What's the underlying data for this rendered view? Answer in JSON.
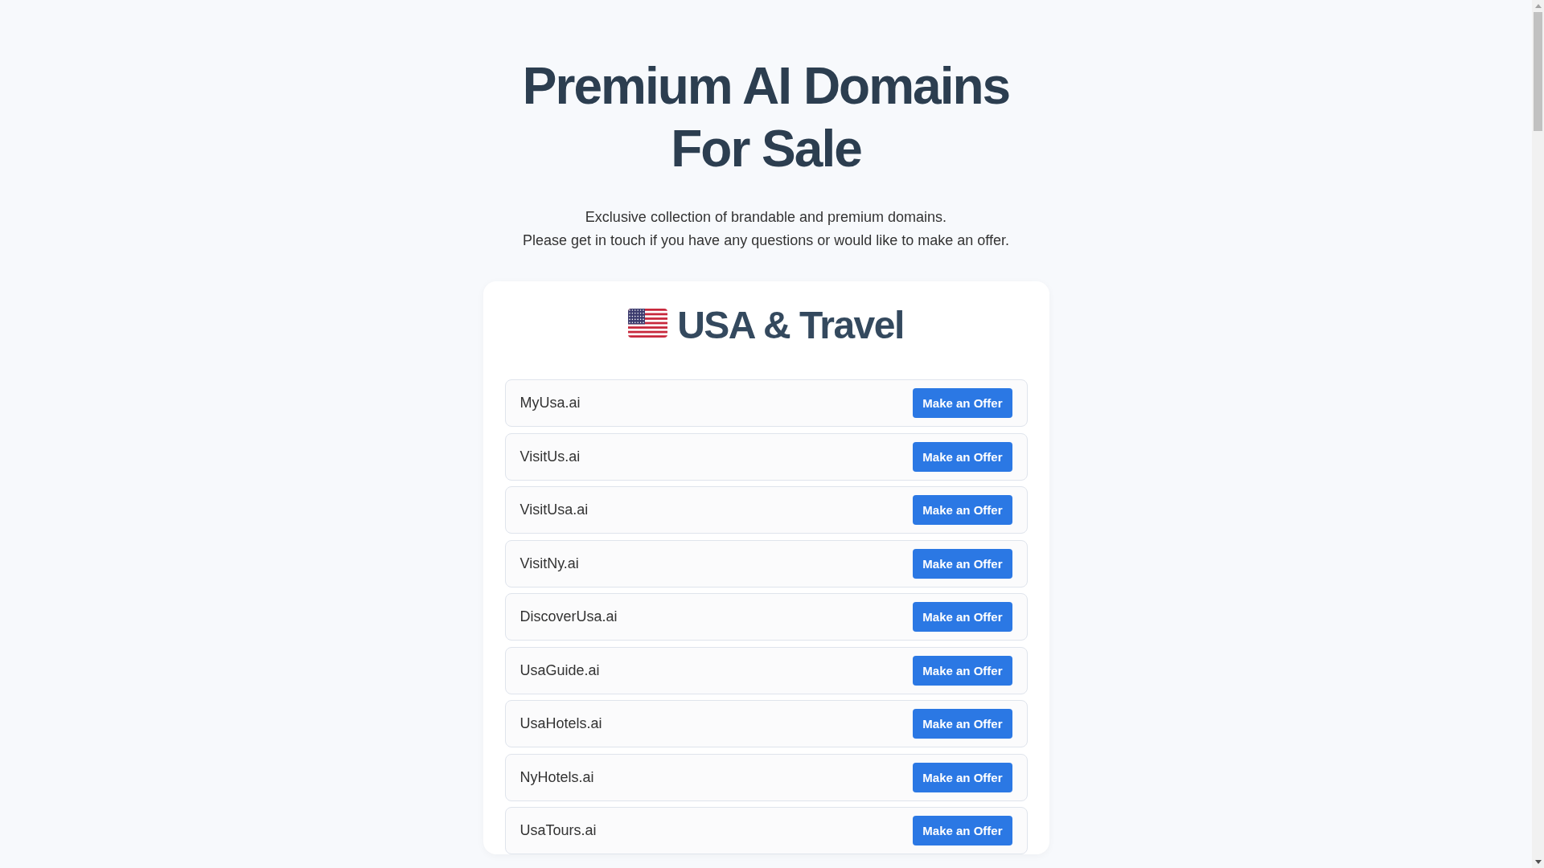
{
  "heading": {
    "title_lines": [
      "Premium AI Domains",
      "For Sale"
    ],
    "subtitle_lines": [
      "Exclusive collection of brandable and premium domains.",
      "Please get in touch if you have any questions or would like to make an offer."
    ]
  },
  "category": {
    "title": "USA & Travel",
    "domains": [
      {
        "name": "MyUsa.ai",
        "button": "Make an Offer"
      },
      {
        "name": "VisitUs.ai",
        "button": "Make an Offer"
      },
      {
        "name": "VisitUsa.ai",
        "button": "Make an Offer"
      },
      {
        "name": "VisitNy.ai",
        "button": "Make an Offer"
      },
      {
        "name": "DiscoverUsa.ai",
        "button": "Make an Offer"
      },
      {
        "name": "UsaGuide.ai",
        "button": "Make an Offer"
      },
      {
        "name": "UsaHotels.ai",
        "button": "Make an Offer"
      },
      {
        "name": "NyHotels.ai",
        "button": "Make an Offer"
      },
      {
        "name": "UsaTours.ai",
        "button": "Make an Offer"
      }
    ]
  }
}
